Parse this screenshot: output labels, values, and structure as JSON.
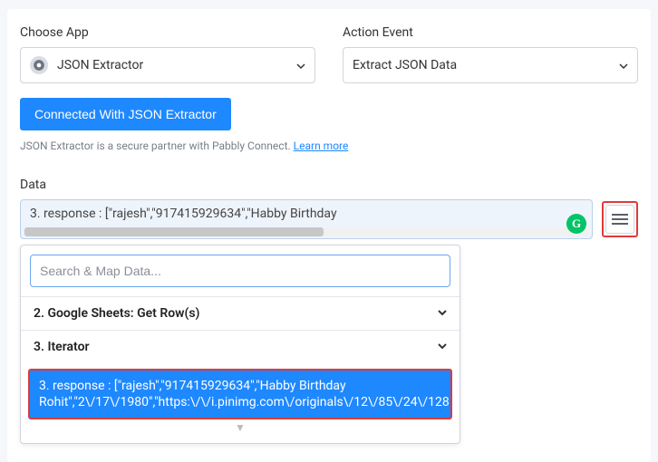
{
  "choose_app": {
    "label": "Choose App",
    "value": "JSON Extractor"
  },
  "action_event": {
    "label": "Action Event",
    "value": "Extract JSON Data"
  },
  "connect_button": "Connected With JSON Extractor",
  "help_text": "JSON Extractor is a secure partner with Pabbly Connect.",
  "help_link": "Learn more",
  "data": {
    "label": "Data",
    "value_line1": "3. response : [\"rajesh\",\"917415929634\",\"Habby Birthday",
    "search_placeholder": "Search & Map Data...",
    "items": [
      {
        "label": "2. Google Sheets: Get Row(s)"
      },
      {
        "label": "3. Iterator"
      }
    ],
    "selected_line1": "3. response : [\"rajesh\",\"917415929634\",\"Habby Birthday",
    "selected_line2": "Rohit\",\"2\\/17\\/1980\",\"https:\\/\\/i.pinimg.com\\/originals\\/12\\/85\\/24\\/128"
  },
  "g_badge": "G"
}
